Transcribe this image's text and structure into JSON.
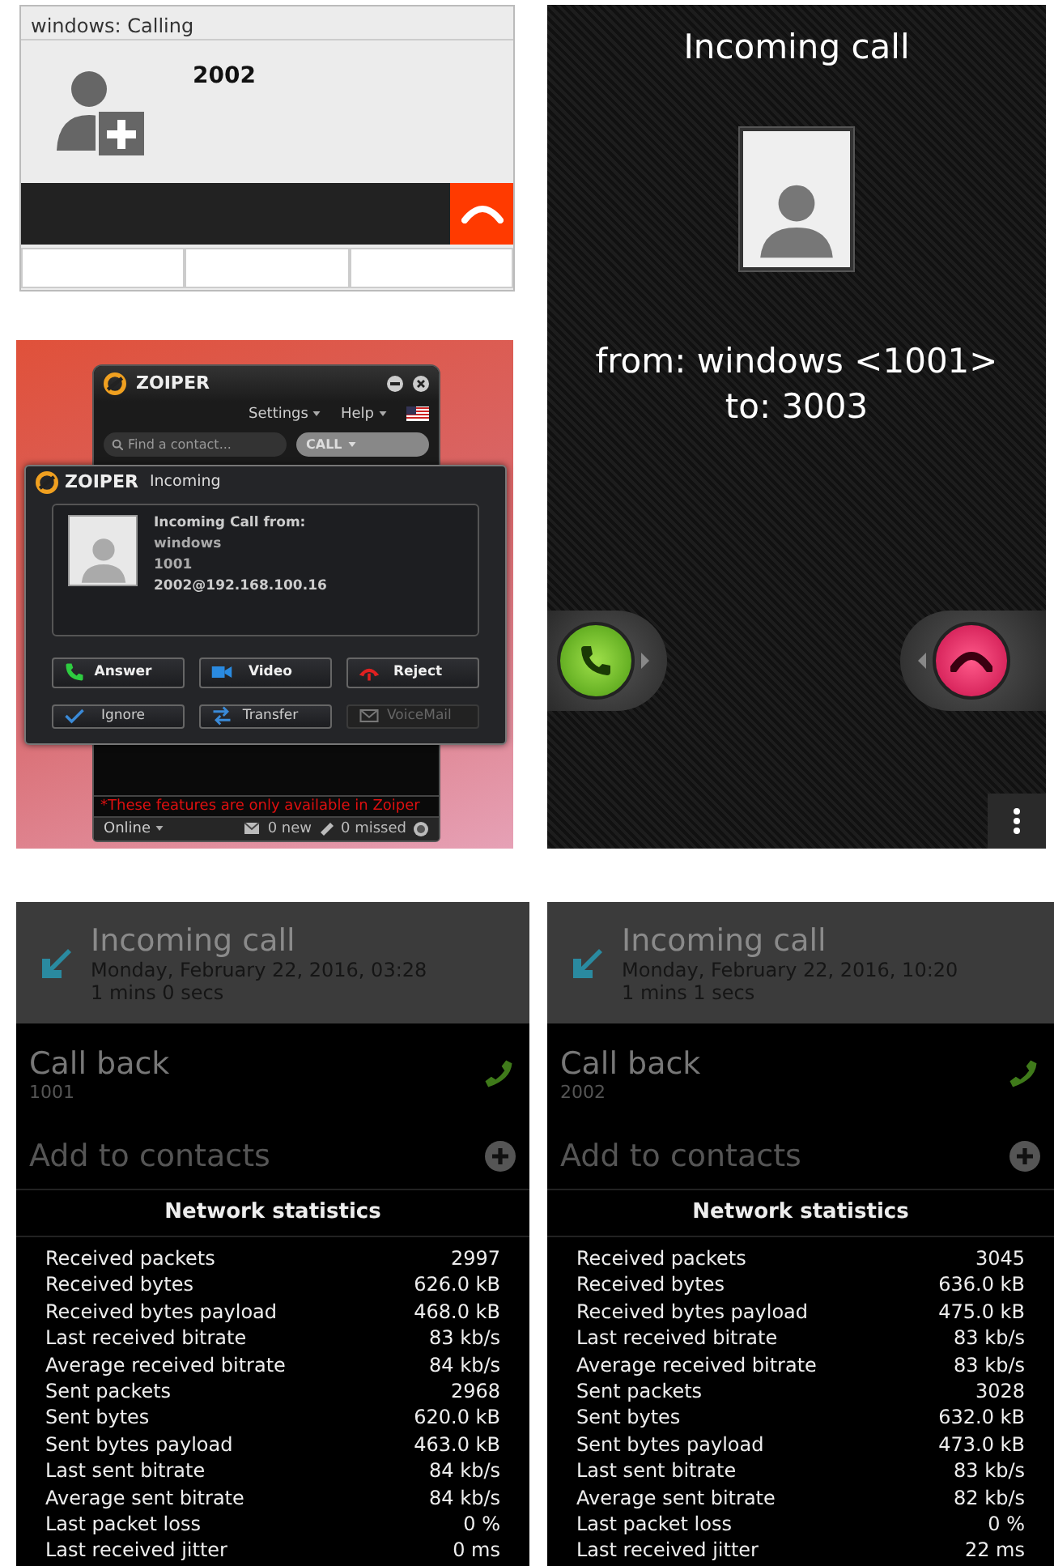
{
  "calling_window": {
    "title": "windows: Calling",
    "number": "2002"
  },
  "incoming_screen": {
    "title": "Incoming call",
    "from": "from: windows <1001>",
    "to": "to: 3003"
  },
  "zoiper": {
    "main": {
      "brand": "ZOIPER",
      "menus": [
        "Settings",
        "Help"
      ],
      "search_placeholder": "Find a contact...",
      "call_button": "CALL",
      "notice": "*These features are only available in Zoiper",
      "status": "Online",
      "new_count": "0 new",
      "missed_count": "0 missed"
    },
    "dialog": {
      "brand": "ZOIPER",
      "title": "Incoming",
      "heading": "Incoming Call from:",
      "caller_name": "windows",
      "caller_number": "1001",
      "account": "2002@192.168.100.16",
      "main_buttons": [
        {
          "label": "Answer",
          "kind": "answer",
          "disabled": false
        },
        {
          "label": "Video",
          "kind": "video",
          "disabled": false
        },
        {
          "label": "Reject",
          "kind": "reject",
          "disabled": false
        }
      ],
      "secondary_buttons": [
        {
          "label": "Ignore",
          "kind": "ignore",
          "disabled": false
        },
        {
          "label": "Transfer",
          "kind": "transfer",
          "disabled": false
        },
        {
          "label": "VoiceMail",
          "kind": "voicemail",
          "disabled": true
        }
      ]
    }
  },
  "call_logs": [
    {
      "title": "Incoming call",
      "date": "Monday, February 22, 2016, 03:28",
      "duration": "1 mins 0 secs",
      "callback_label": "Call back",
      "callback_number": "1001",
      "add_contact": "Add to contacts",
      "stats_title": "Network statistics",
      "stats": [
        {
          "label": "Received packets",
          "value": "2997"
        },
        {
          "label": "Received bytes",
          "value": "626.0 kB"
        },
        {
          "label": "Received bytes payload",
          "value": "468.0 kB"
        },
        {
          "label": "Last received bitrate",
          "value": "83 kb/s"
        },
        {
          "label": "Average received bitrate",
          "value": "84 kb/s"
        },
        {
          "label": "Sent packets",
          "value": "2968"
        },
        {
          "label": "Sent bytes",
          "value": "620.0 kB"
        },
        {
          "label": "Sent bytes payload",
          "value": "463.0 kB"
        },
        {
          "label": "Last sent bitrate",
          "value": "84 kb/s"
        },
        {
          "label": "Average sent bitrate",
          "value": "84 kb/s"
        },
        {
          "label": "Last packet loss",
          "value": "0 %"
        },
        {
          "label": "Last received jitter",
          "value": "0 ms"
        }
      ]
    },
    {
      "title": "Incoming call",
      "date": "Monday, February 22, 2016, 10:20",
      "duration": "1 mins 1 secs",
      "callback_label": "Call back",
      "callback_number": "2002",
      "add_contact": "Add to contacts",
      "stats_title": "Network statistics",
      "stats": [
        {
          "label": "Received packets",
          "value": "3045"
        },
        {
          "label": "Received bytes",
          "value": "636.0 kB"
        },
        {
          "label": "Received bytes payload",
          "value": "475.0 kB"
        },
        {
          "label": "Last received bitrate",
          "value": "83 kb/s"
        },
        {
          "label": "Average received bitrate",
          "value": "83 kb/s"
        },
        {
          "label": "Sent packets",
          "value": "3028"
        },
        {
          "label": "Sent bytes",
          "value": "632.0 kB"
        },
        {
          "label": "Sent bytes payload",
          "value": "473.0 kB"
        },
        {
          "label": "Last sent bitrate",
          "value": "83 kb/s"
        },
        {
          "label": "Average sent bitrate",
          "value": "82 kb/s"
        },
        {
          "label": "Last packet loss",
          "value": "0 %"
        },
        {
          "label": "Last received jitter",
          "value": "22 ms"
        }
      ]
    }
  ]
}
